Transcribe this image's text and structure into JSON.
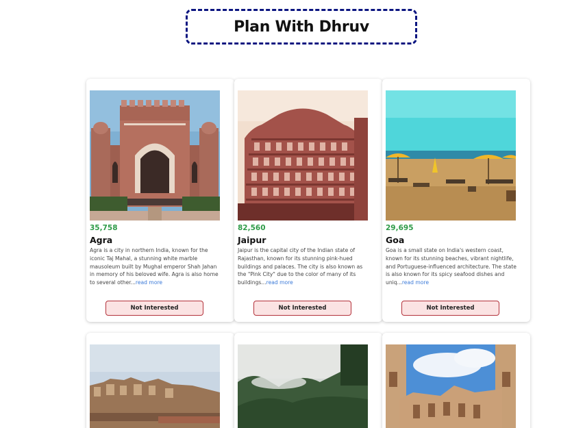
{
  "header": {
    "title": "Plan With Dhruv"
  },
  "tours": [
    {
      "price": "35,758",
      "name": "Agra",
      "info": "Agra is a city in northern India, known for the iconic Taj Mahal, a stunning white marble mausoleum built by Mughal emperor Shah Jahan in memory of his beloved wife. Agra is also home to several other...",
      "read_more": "read more",
      "button": "Not Interested"
    },
    {
      "price": "82,560",
      "name": "Jaipur",
      "info": "Jaipur is the capital city of the Indian state of Rajasthan, known for its stunning pink-hued buildings and palaces. The city is also known as the \"Pink City\" due to the color of many of its buildings...",
      "read_more": "read more",
      "button": "Not Interested"
    },
    {
      "price": "29,695",
      "name": "Goa",
      "info": "Goa is a small state on India's western coast, known for its stunning beaches, vibrant nightlife, and Portuguese-influenced architecture. The state is also known for its spicy seafood dishes and uniq...",
      "read_more": "read more",
      "button": "Not Interested"
    }
  ],
  "colors": {
    "title_border": "#0b1580",
    "price": "#2e9b48",
    "read_more": "#3b7ad8",
    "button_bg": "#fbe3e3",
    "button_border": "#b3313a"
  }
}
